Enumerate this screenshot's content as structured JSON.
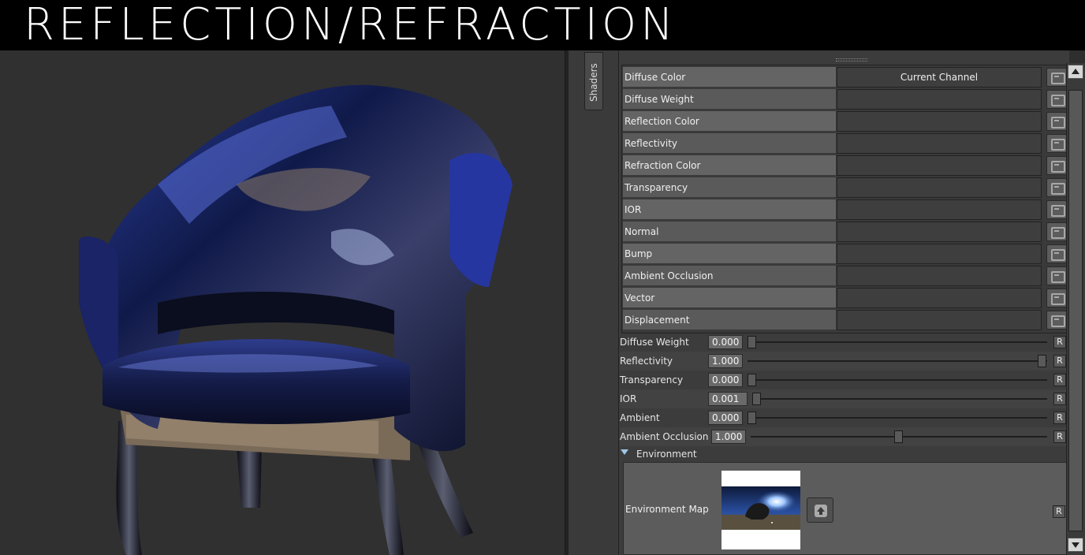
{
  "title": "REFLECTION/REFRACTION",
  "side_tab": {
    "label": "Shaders"
  },
  "channels": [
    {
      "label": "Diffuse Color",
      "value": "Current Channel"
    },
    {
      "label": "Diffuse Weight",
      "value": ""
    },
    {
      "label": "Reflection Color",
      "value": ""
    },
    {
      "label": "Reflectivity",
      "value": ""
    },
    {
      "label": "Refraction Color",
      "value": ""
    },
    {
      "label": "Transparency",
      "value": ""
    },
    {
      "label": "IOR",
      "value": ""
    },
    {
      "label": "Normal",
      "value": ""
    },
    {
      "label": "Bump",
      "value": ""
    },
    {
      "label": "Ambient Occlusion",
      "value": ""
    },
    {
      "label": "Vector",
      "value": ""
    },
    {
      "label": "Displacement",
      "value": ""
    }
  ],
  "sliders": [
    {
      "label": "Diffuse Weight",
      "value": "0.000",
      "level": 0.0
    },
    {
      "label": "Reflectivity",
      "value": "1.000",
      "level": 1.0
    },
    {
      "label": "Transparency",
      "value": "0.000",
      "level": 0.0
    },
    {
      "label": "IOR",
      "value": "0.001",
      "level": 0.0
    },
    {
      "label": "Ambient",
      "value": "0.000",
      "level": 0.0
    },
    {
      "label": "Ambient Occlusion",
      "value": "1.000",
      "level": 0.5
    }
  ],
  "reset_label": "R",
  "environment": {
    "section_label": "Environment",
    "map_label": "Environment Map",
    "reset_label": "R"
  },
  "icons": {
    "channel_button": "add-map-icon",
    "upload": "upload-icon",
    "section_toggle": "triangle-down-icon"
  }
}
